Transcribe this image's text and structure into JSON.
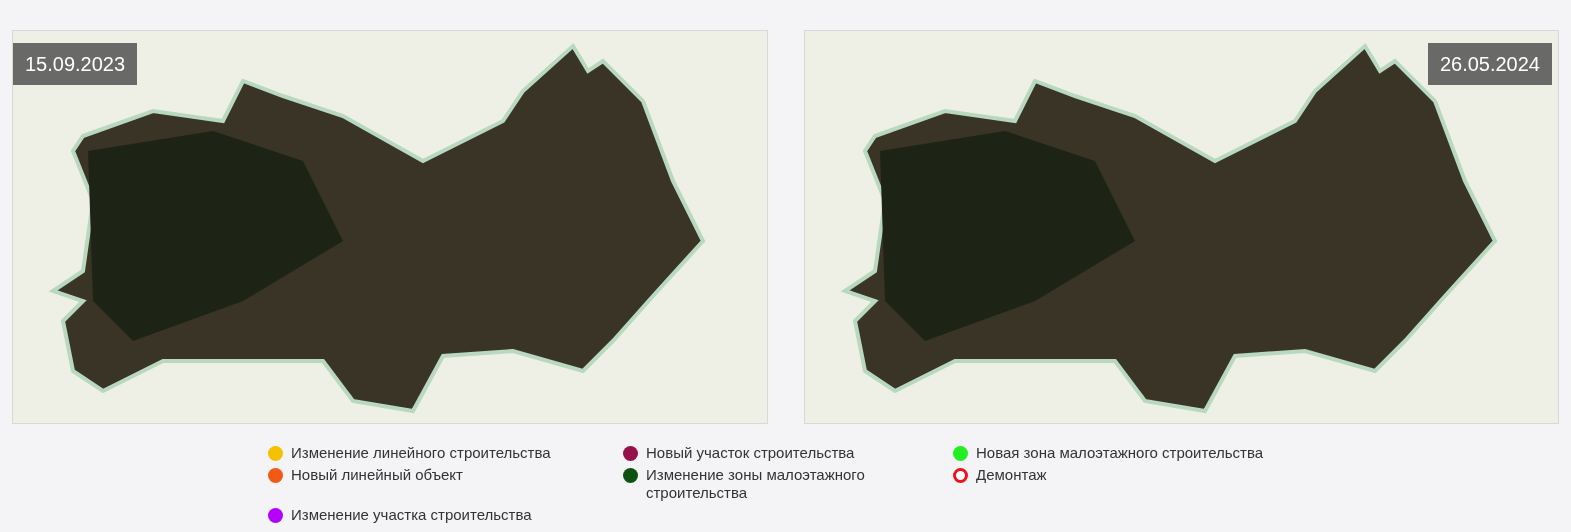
{
  "maps": [
    {
      "date": "15.09.2023",
      "date_on_right": false
    },
    {
      "date": "26.05.2024",
      "date_on_right": true
    }
  ],
  "legend": [
    {
      "label": "Изменение линейного строительства",
      "kind": "dot",
      "color": "#f5c000"
    },
    {
      "label": "Новый линейный объект",
      "kind": "dot",
      "color": "#f05a14"
    },
    {
      "label": "Изменение участка строительства",
      "kind": "dot",
      "color": "#b400ff"
    },
    {
      "label": "Новый участок строительства",
      "kind": "dot",
      "color": "#96104a"
    },
    {
      "label": "Изменение зоны малоэтажного строительства",
      "kind": "dot",
      "color": "#0d5210"
    },
    {
      "label": "Новая зона малоэтажного строительства",
      "kind": "dot",
      "color": "#22ee22"
    },
    {
      "label": "Демонтаж",
      "kind": "ring",
      "color": "#e8141e"
    }
  ]
}
